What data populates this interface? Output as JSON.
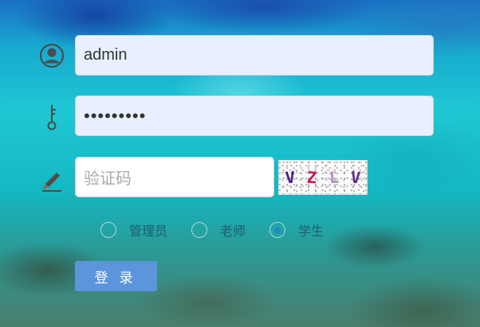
{
  "login_form": {
    "username": {
      "value": "admin",
      "icon": "user-circle-icon"
    },
    "password": {
      "value": "•••••••••",
      "icon": "key-icon"
    },
    "captcha": {
      "placeholder": "验证码",
      "icon": "pencil-icon",
      "image_text": [
        "V",
        "Z",
        "L",
        "V"
      ]
    },
    "roles": [
      {
        "label": "管理员",
        "checked": false
      },
      {
        "label": "老师",
        "checked": false
      },
      {
        "label": "学生",
        "checked": true
      }
    ],
    "submit_label": "登录"
  },
  "colors": {
    "field_bg": "#e8f0fe",
    "button_bg": "#5d95dc",
    "icon": "#4b4b4b",
    "captcha_chars": [
      "#4a1a8c",
      "#c2185b",
      "#b58ac6",
      "#5e2a7e"
    ]
  }
}
